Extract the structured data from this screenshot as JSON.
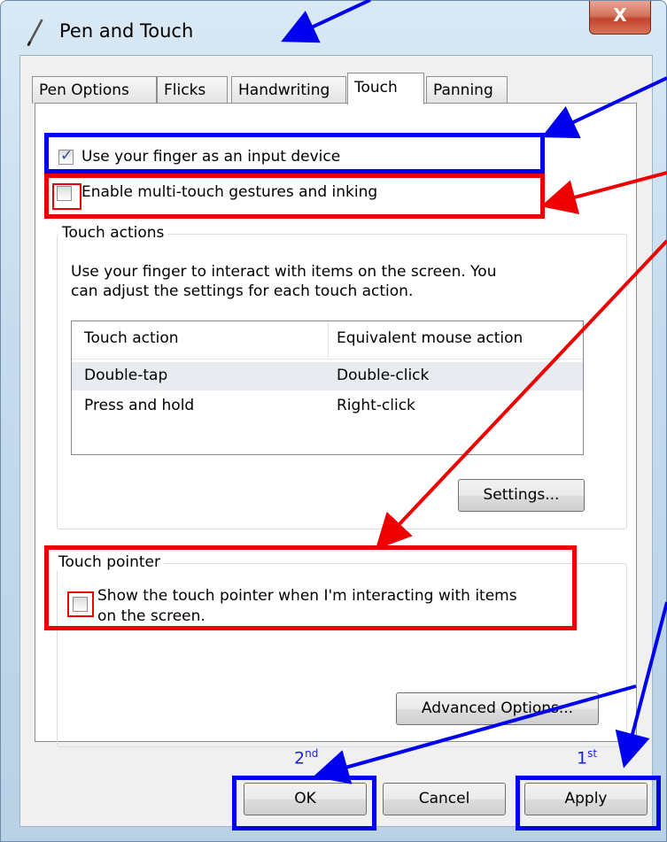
{
  "window": {
    "title": "Pen and Touch",
    "close_label": "X"
  },
  "tabs": [
    {
      "label": "Pen Options"
    },
    {
      "label": "Flicks"
    },
    {
      "label": "Handwriting"
    },
    {
      "label": "Touch",
      "active": true
    },
    {
      "label": "Panning"
    }
  ],
  "touch": {
    "use_finger_label": "Use your finger as an input device",
    "use_finger_checked": true,
    "multitouch_label": "Enable multi-touch gestures and inking",
    "multitouch_checked": false
  },
  "touch_actions": {
    "group_title": "Touch actions",
    "description_line1": "Use your finger to interact with items on the screen. You",
    "description_line2": "can adjust the settings for each touch action.",
    "columns": [
      "Touch action",
      "Equivalent mouse action"
    ],
    "rows": [
      {
        "action": "Double-tap",
        "mouse": "Double-click",
        "selected": true
      },
      {
        "action": "Press and hold",
        "mouse": "Right-click",
        "selected": false
      }
    ],
    "settings_button": "Settings..."
  },
  "touch_pointer": {
    "group_title": "Touch pointer",
    "show_pointer_line1": "Show the touch pointer when I'm interacting with items",
    "show_pointer_line2": "on the screen.",
    "show_pointer_checked": false,
    "advanced_button": "Advanced Options..."
  },
  "footer": {
    "ok": "OK",
    "cancel": "Cancel",
    "apply": "Apply"
  },
  "annotations": {
    "second": "2",
    "second_sup": "nd",
    "first": "1",
    "first_sup": "st",
    "blue_color": "#0000ee",
    "red_color": "#ee0000"
  }
}
